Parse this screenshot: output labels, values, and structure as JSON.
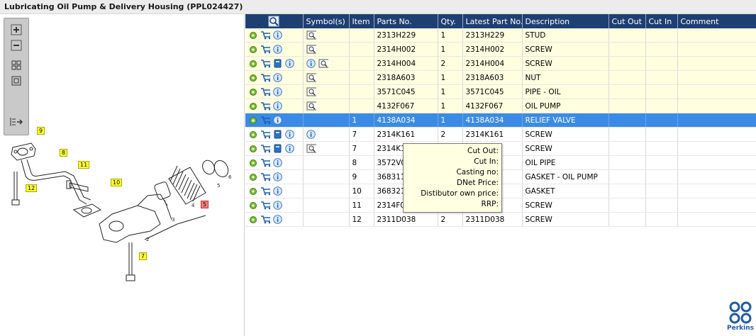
{
  "window": {
    "title": "Lubricating Oil Pump & Delivery Housing (PPL024427)"
  },
  "diagram": {
    "callouts": [
      "9",
      "8",
      "11",
      "12",
      "10",
      "7",
      "5"
    ],
    "part_labels": [
      "1",
      "2",
      "3",
      "4",
      "5",
      "6"
    ]
  },
  "table": {
    "headers": {
      "symbols": "Symbol(s)",
      "item": "Item",
      "parts_no": "Parts No.",
      "qty": "Qty.",
      "latest_part_no": "Latest Part No.",
      "description": "Description",
      "cut_out": "Cut Out",
      "cut_in": "Cut In",
      "comment": "Comment"
    },
    "rows": [
      {
        "item": "",
        "part": "2313H229",
        "qty": "1",
        "latest": "2313H229",
        "desc": "STUD",
        "book": false,
        "info": false,
        "sym": true
      },
      {
        "item": "",
        "part": "2314H002",
        "qty": "1",
        "latest": "2314H002",
        "desc": "SCREW",
        "book": false,
        "info": false,
        "sym": true
      },
      {
        "item": "",
        "part": "2314H004",
        "qty": "2",
        "latest": "2314H004",
        "desc": "SCREW",
        "book": true,
        "info": true,
        "sym": true
      },
      {
        "item": "",
        "part": "2318A603",
        "qty": "1",
        "latest": "2318A603",
        "desc": "NUT",
        "book": false,
        "info": false,
        "sym": true
      },
      {
        "item": "",
        "part": "3571C045",
        "qty": "1",
        "latest": "3571C045",
        "desc": "PIPE - OIL",
        "book": false,
        "info": false,
        "sym": true
      },
      {
        "item": "",
        "part": "4132F067",
        "qty": "1",
        "latest": "4132F067",
        "desc": "OIL PUMP",
        "book": false,
        "info": false,
        "sym": true
      },
      {
        "item": "1",
        "part": "4138A034",
        "qty": "1",
        "latest": "4138A034",
        "desc": "RELIEF VALVE",
        "book": false,
        "info": false,
        "sym": false
      },
      {
        "item": "7",
        "part": "2314K161",
        "qty": "2",
        "latest": "2314K161",
        "desc": "SCREW",
        "book": true,
        "info": true,
        "sym": false
      },
      {
        "item": "7",
        "part": "2314K16",
        "qty": "",
        "latest": "",
        "desc": "SCREW",
        "book": true,
        "info": false,
        "sym": true
      },
      {
        "item": "8",
        "part": "3572V0",
        "qty": "",
        "latest": "",
        "desc": "OIL PIPE",
        "book": false,
        "info": false,
        "sym": false
      },
      {
        "item": "9",
        "part": "368311",
        "qty": "",
        "latest": "",
        "desc": "GASKET - OIL PUMP",
        "book": false,
        "info": false,
        "sym": false
      },
      {
        "item": "10",
        "part": "368321",
        "qty": "",
        "latest": "",
        "desc": "GASKET",
        "book": false,
        "info": false,
        "sym": false
      },
      {
        "item": "11",
        "part": "2314F0",
        "qty": "",
        "latest": "",
        "desc": "SCREW",
        "book": false,
        "info": false,
        "sym": false
      },
      {
        "item": "12",
        "part": "2311D038",
        "qty": "2",
        "latest": "2311D038",
        "desc": "SCREW",
        "book": false,
        "info": false,
        "sym": false
      }
    ]
  },
  "tooltip": {
    "cut_out": "Cut Out:",
    "cut_in": "Cut In:",
    "casting_no": "Casting no:",
    "dnet_price": "DNet Price:",
    "distributor_price": "Distibutor own price:",
    "rrp": "RRP:"
  },
  "brand": {
    "name": "Perkins"
  },
  "icons": {
    "cart": "cart-icon",
    "gear": "gear-icon",
    "info": "info-icon",
    "book": "book-icon",
    "symbol": "symbol-view-icon",
    "header": "search-drawing-icon"
  },
  "colors": {
    "header_bg": "#1e3f72",
    "row_yellow": "#ffffe0",
    "row_selected": "#3b8be6",
    "callout_yellow": "#ffff33",
    "brand_blue": "#1f5aa8"
  }
}
